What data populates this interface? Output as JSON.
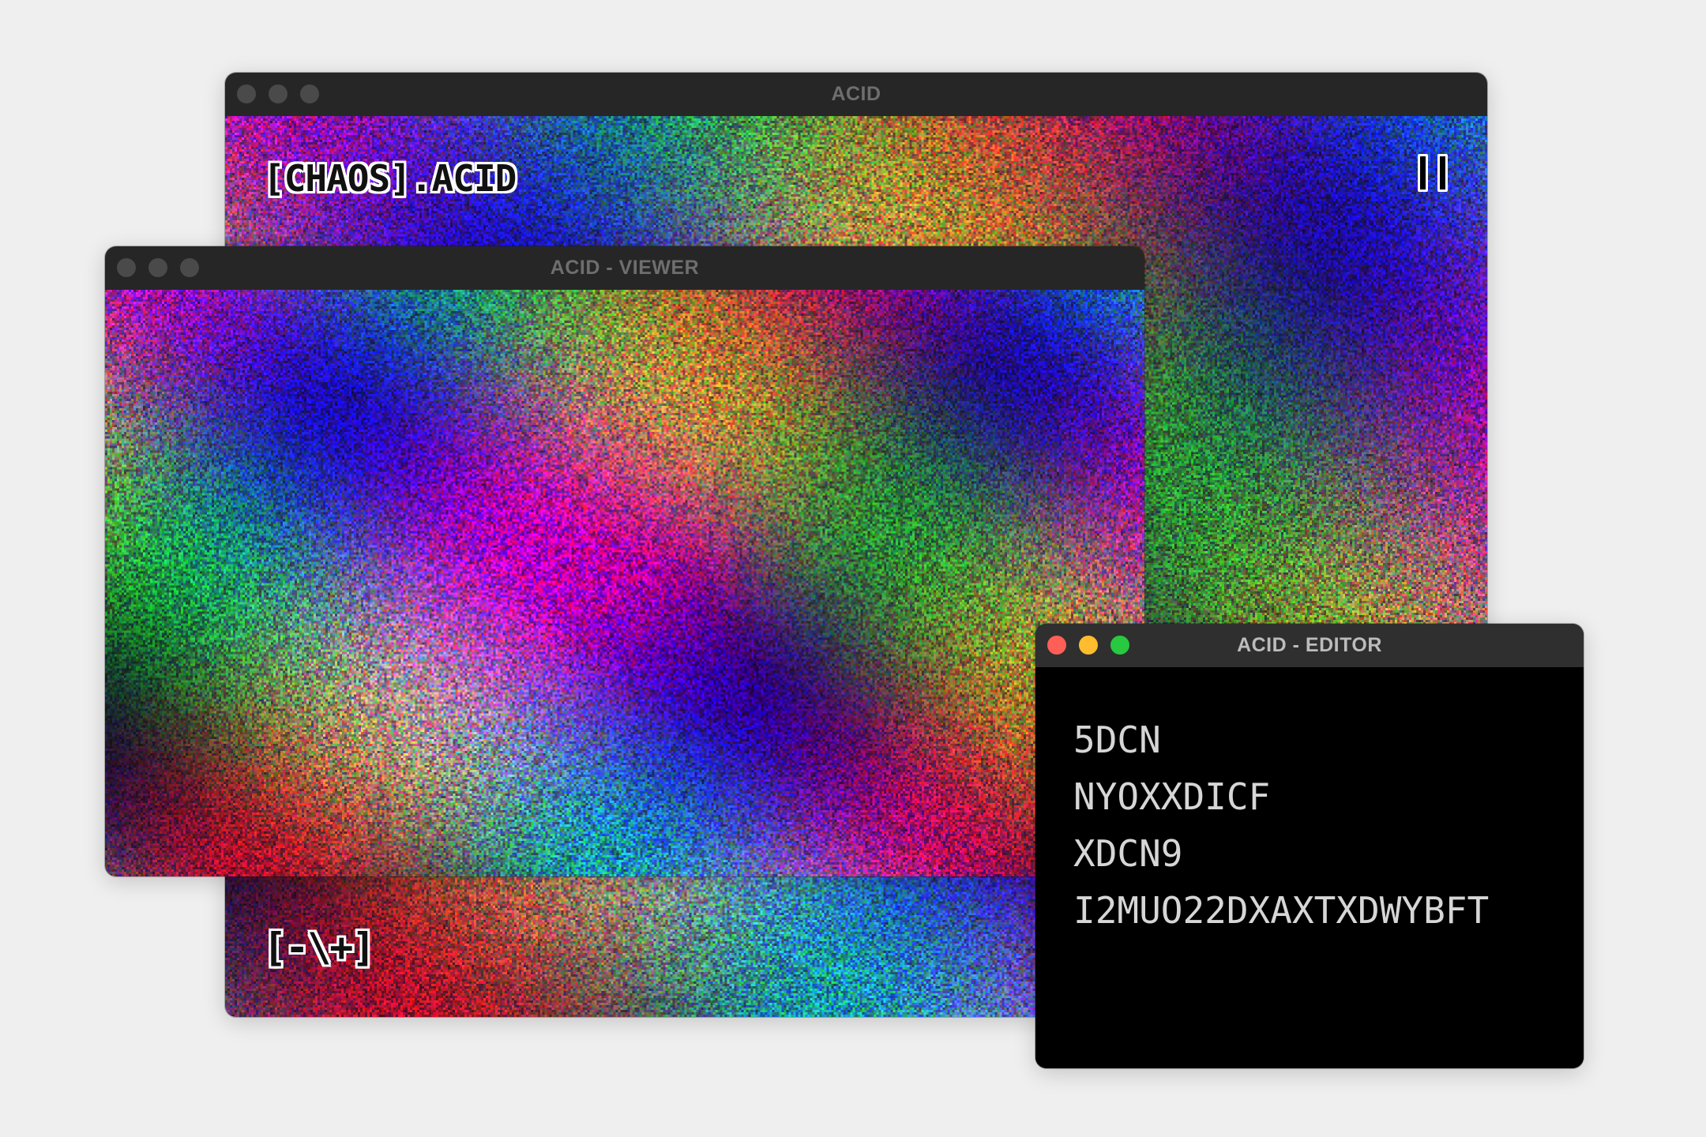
{
  "windows": {
    "main": {
      "title": "ACID",
      "label": "[CHAOS].ACID",
      "symbol": "[-\\+]",
      "pause_icon": "pause-icon"
    },
    "viewer": {
      "title": "ACID - VIEWER"
    },
    "editor": {
      "title": "ACID - EDITOR",
      "lines": [
        "5DCN",
        "NYOXXDICF",
        "XDCN9",
        "I2MUO22DXAXTXDWYBFT"
      ]
    }
  },
  "colors": {
    "background": "#efefef",
    "titlebar": "#262626",
    "traffic_red": "#ff5f57",
    "traffic_yellow": "#febc2e",
    "traffic_green": "#28c840",
    "editor_bg": "#000000",
    "editor_text": "#d6d6d6"
  }
}
